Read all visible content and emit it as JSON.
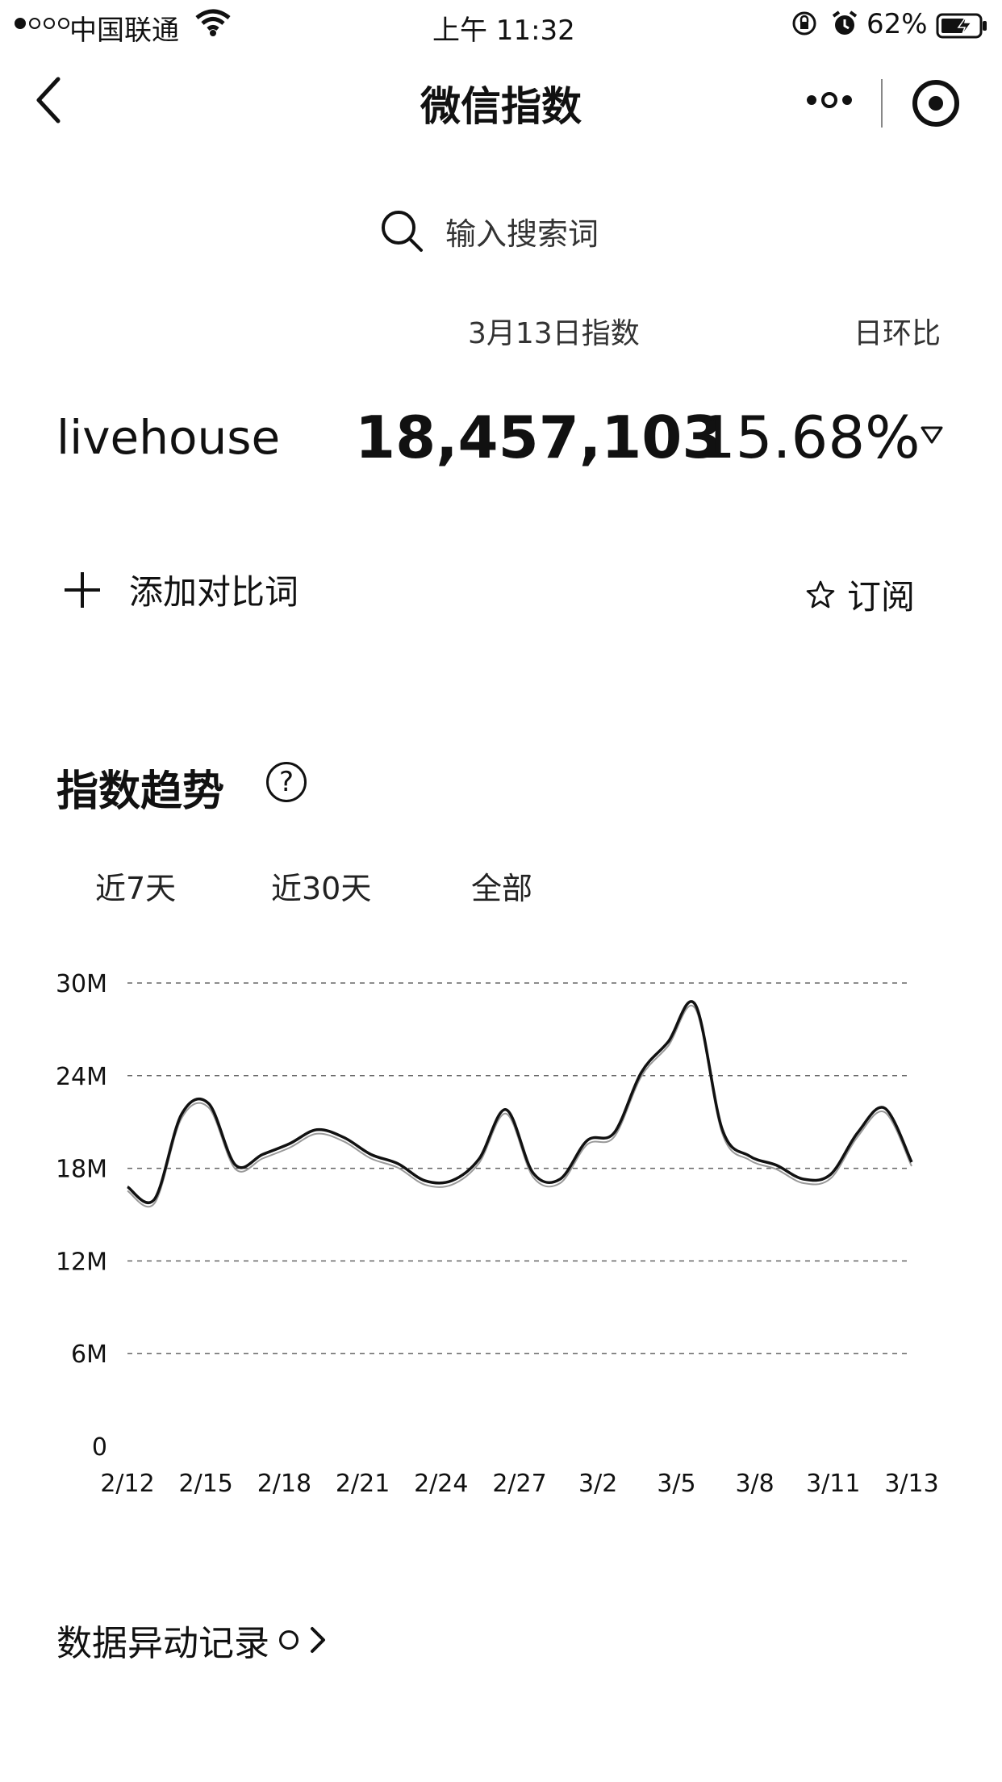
{
  "status_bar": {
    "carrier": "中国联通",
    "time": "上午 11:32",
    "battery": "62%",
    "icons": [
      "signal-icon",
      "wifi-icon",
      "rotation-lock-icon",
      "alarm-icon",
      "battery-charging-icon"
    ]
  },
  "nav": {
    "title": "微信指数",
    "icons": [
      "back-icon",
      "more-icon",
      "target-icon"
    ]
  },
  "search": {
    "placeholder": "输入搜索词"
  },
  "summary": {
    "date_label": "3月13日指数",
    "ratio_label": "日环比",
    "keyword": "livehouse",
    "index_value": "18,457,103",
    "ratio_value": "15.68%",
    "trend_direction": "down"
  },
  "actions": {
    "add_compare": "添加对比词",
    "subscribe": "订阅"
  },
  "trend": {
    "title": "指数趋势",
    "help": "?",
    "tabs": [
      "近7天",
      "近30天",
      "全部"
    ]
  },
  "records": {
    "label": "数据异动记录"
  },
  "chart_data": {
    "type": "line",
    "y_ticks": [
      "0",
      "6M",
      "12M",
      "18M",
      "24M",
      "30M"
    ],
    "ylim": [
      0,
      30000000
    ],
    "x_labels": [
      "2/12",
      "2/15",
      "2/18",
      "2/21",
      "2/24",
      "2/27",
      "3/2",
      "3/5",
      "3/8",
      "3/11",
      "3/13"
    ],
    "grid": "dashed horizontal",
    "series": [
      {
        "x": [
          "2/12",
          "2/13",
          "2/14",
          "2/15",
          "2/16",
          "2/17",
          "2/18",
          "2/19",
          "2/20",
          "2/21",
          "2/22",
          "2/23",
          "2/24",
          "2/25",
          "2/26",
          "2/27",
          "2/28",
          "3/1",
          "3/2",
          "3/3",
          "3/4",
          "3/5",
          "3/6",
          "3/7",
          "3/8",
          "3/9",
          "3/10",
          "3/11",
          "3/12",
          "3/13"
        ],
        "values": [
          16.8,
          16.0,
          21.5,
          22.2,
          18.2,
          18.9,
          19.6,
          20.5,
          20.0,
          18.9,
          18.3,
          17.2,
          17.2,
          18.6,
          21.8,
          17.7,
          17.3,
          19.8,
          20.3,
          24.2,
          26.2,
          28.6,
          20.5,
          18.8,
          18.2,
          17.3,
          17.6,
          20.3,
          21.9,
          18.4
        ]
      }
    ]
  }
}
